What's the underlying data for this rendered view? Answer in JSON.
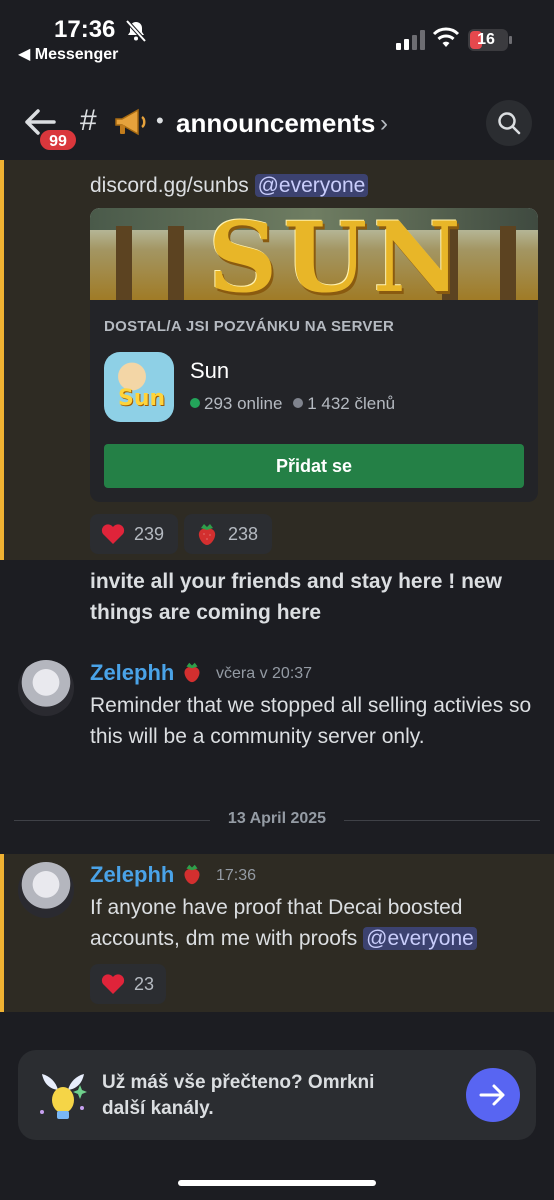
{
  "status_bar": {
    "time": "17:36",
    "back_app": "◀ Messenger",
    "battery": "16"
  },
  "header": {
    "badge": "99",
    "hash": "#",
    "separator": "•",
    "channel": "announcements",
    "chevron": "›"
  },
  "messages": {
    "m0_prefix": "discord.gg/sunbs",
    "m0_mention": "@everyone",
    "invite": {
      "banner_text": "SUN",
      "heading": "DOSTAL/A JSI POZVÁNKU NA SERVER",
      "server_name": "Sun",
      "icon_text": "Sun",
      "online": "293 online",
      "members": "1 432 členů",
      "join_label": "Přidat se"
    },
    "reactions_1": [
      {
        "emoji": "heart-icon",
        "count": "239"
      },
      {
        "emoji": "strawberry-icon",
        "count": "238"
      }
    ],
    "bold_text": "invite all your friends and stay here ! new things are coming here",
    "msg1": {
      "username": "Zelephh",
      "time": "včera v 20:37",
      "text": "Reminder that we stopped all selling activies so this will be a community server only."
    },
    "date_divider": "13 April 2025",
    "msg2": {
      "username": "Zelephh",
      "time": "17:36",
      "text": "If anyone have proof that Decai boosted accounts, dm me with proofs",
      "mention": "@everyone"
    },
    "reactions_2": [
      {
        "emoji": "heart-icon",
        "count": "23"
      }
    ]
  },
  "footer": {
    "text": "Už máš vše přečteno? Omrkni další kanály."
  },
  "colors": {
    "accent": "#5865f2",
    "join_green": "#248046",
    "highlight_bar": "#f0b232",
    "username": "#4aa3e8",
    "badge_red": "#da373c"
  }
}
